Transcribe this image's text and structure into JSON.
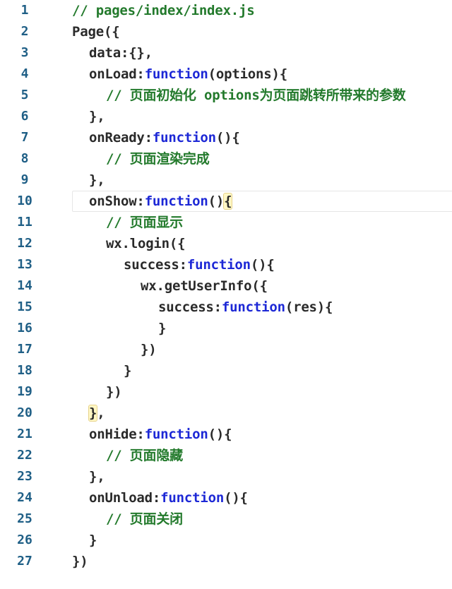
{
  "lines": [
    {
      "n": "1",
      "c": "// pages/index/index.js"
    },
    {
      "n": "2",
      "c": "Page({"
    },
    {
      "n": "3",
      "c": "data:{},"
    },
    {
      "n": "4",
      "p": "onLoad:",
      "k": "function",
      "s": "(options){"
    },
    {
      "n": "5",
      "c": "// 页面初始化 options为页面跳转所带来的参数"
    },
    {
      "n": "6",
      "c": "},"
    },
    {
      "n": "7",
      "p": "onReady:",
      "k": "function",
      "s": "(){"
    },
    {
      "n": "8",
      "c": "// 页面渲染完成"
    },
    {
      "n": "9",
      "c": "},"
    },
    {
      "n": "10",
      "p": "onShow:",
      "k": "function",
      "s": "()",
      "hl": "{"
    },
    {
      "n": "11",
      "c": "// 页面显示"
    },
    {
      "n": "12",
      "c": "wx.login({"
    },
    {
      "n": "13",
      "p": "success:",
      "k": "function",
      "s": "(){"
    },
    {
      "n": "14",
      "c": "wx.getUserInfo({"
    },
    {
      "n": "15",
      "p": "success:",
      "k": "function",
      "s": "(res){"
    },
    {
      "n": "16",
      "c": "}"
    },
    {
      "n": "17",
      "c": "})"
    },
    {
      "n": "18",
      "c": "}"
    },
    {
      "n": "19",
      "c": "})"
    },
    {
      "n": "20",
      "hl": "}",
      "s": ","
    },
    {
      "n": "21",
      "p": "onHide:",
      "k": "function",
      "s": "(){"
    },
    {
      "n": "22",
      "c": "// 页面隐藏"
    },
    {
      "n": "23",
      "c": "},"
    },
    {
      "n": "24",
      "p": "onUnload:",
      "k": "function",
      "s": "(){"
    },
    {
      "n": "25",
      "c": "// 页面关闭"
    },
    {
      "n": "26",
      "c": "}"
    },
    {
      "n": "27",
      "c": "})"
    }
  ],
  "colors": {
    "keyword": "#1d28d6",
    "comment": "#237a2c",
    "text": "#2a2a2a",
    "line_number": "#1f5f86",
    "bracket_highlight": "#fff7c4"
  }
}
